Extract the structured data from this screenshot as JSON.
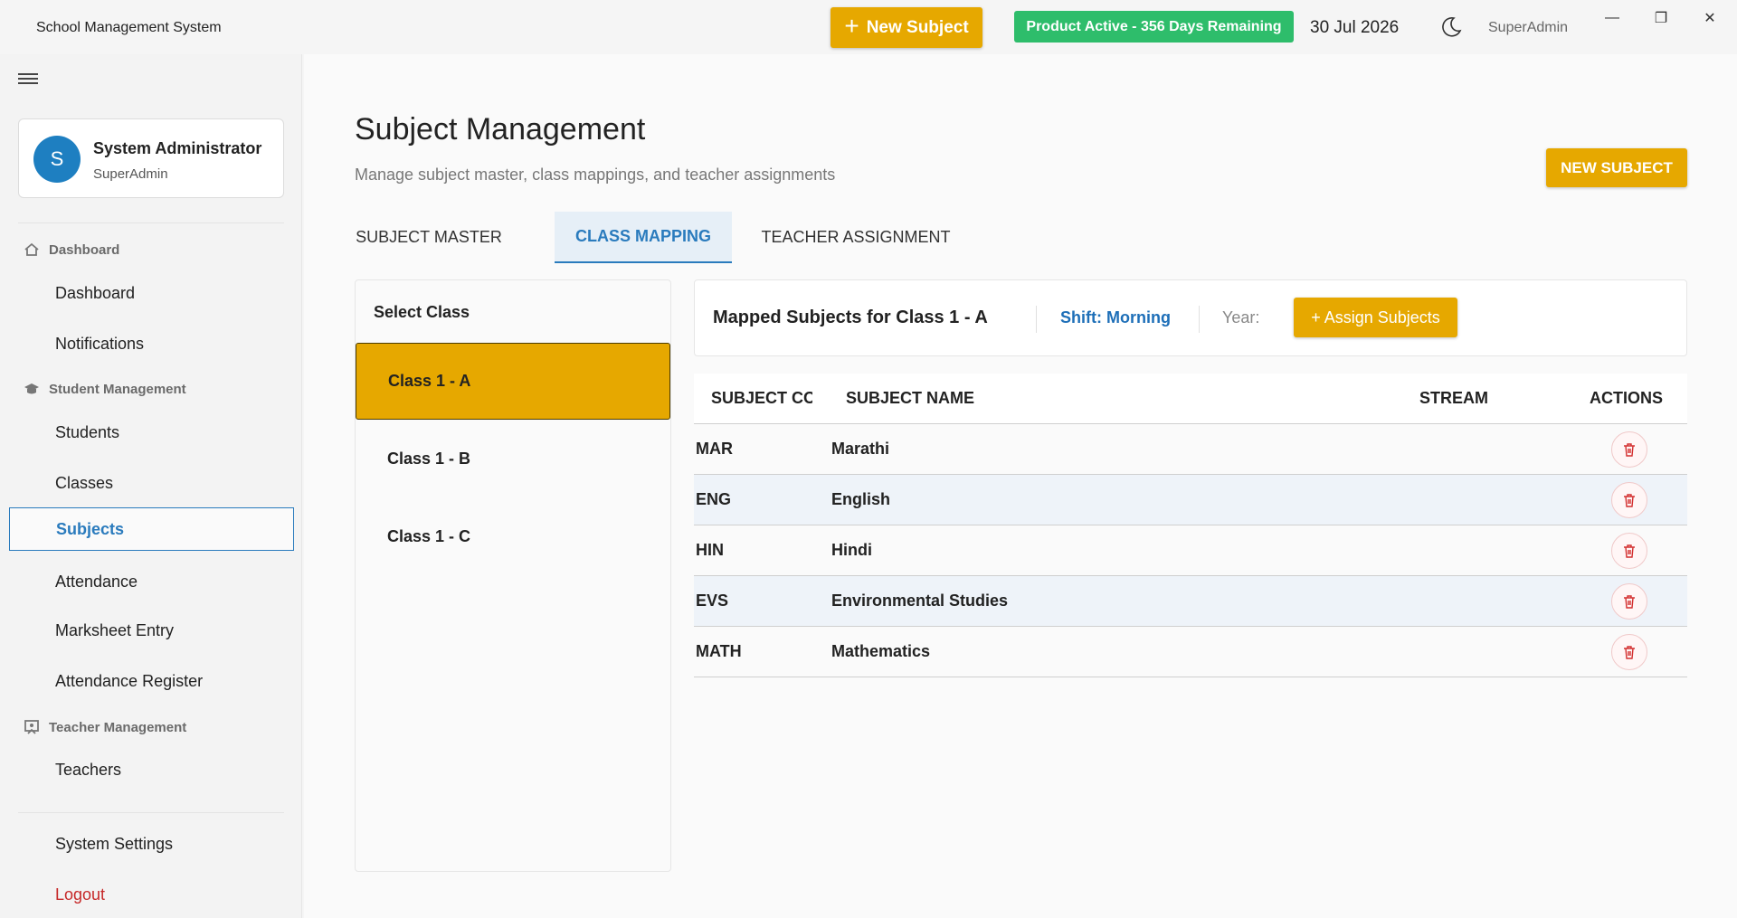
{
  "app": {
    "title": "School Management System",
    "new_subject_label": "New Subject",
    "product_status": "Product Active - 356 Days Remaining",
    "date": "30 Jul 2026",
    "user": "SuperAdmin",
    "theme_icon": "moon-icon"
  },
  "window_controls": {
    "minimize": "—",
    "maximize": "❐",
    "close": "✕"
  },
  "profile": {
    "initial": "S",
    "name": "System Administrator",
    "role": "SuperAdmin"
  },
  "sidebar": {
    "sections": [
      {
        "title": "Dashboard",
        "icon": "home-icon"
      },
      {
        "title": "Student Management",
        "icon": "graduation-cap-icon"
      },
      {
        "title": "Teacher Management",
        "icon": "teacher-icon"
      }
    ],
    "items": [
      {
        "label": "Dashboard"
      },
      {
        "label": "Notifications"
      },
      {
        "label": "Students"
      },
      {
        "label": "Classes"
      },
      {
        "label": "Subjects",
        "active": true
      },
      {
        "label": "Attendance"
      },
      {
        "label": "Marksheet Entry"
      },
      {
        "label": "Attendance Register"
      },
      {
        "label": "Teachers"
      },
      {
        "label": "System Settings"
      },
      {
        "label": "Logout"
      }
    ]
  },
  "page": {
    "title": "Subject Management",
    "subtitle": "Manage subject master, class mappings, and teacher assignments",
    "new_subject_button": "NEW SUBJECT",
    "tabs": [
      {
        "label": "SUBJECT MASTER"
      },
      {
        "label": "CLASS MAPPING",
        "active": true
      },
      {
        "label": "TEACHER ASSIGNMENT"
      }
    ]
  },
  "class_panel": {
    "title": "Select Class",
    "classes": [
      "Class 1 - A",
      "Class 1 - B",
      "Class 1 - C"
    ],
    "selected": "Class 1 - A"
  },
  "mapped": {
    "title": "Mapped Subjects for Class 1 - A",
    "shift": "Shift: Morning",
    "year": "Year:",
    "assign_button": "+ Assign Subjects"
  },
  "table": {
    "columns": [
      "SUBJECT CODE",
      "SUBJECT NAME",
      "STREAM",
      "ACTIONS"
    ],
    "rows": [
      {
        "code": "MAR",
        "name": "Marathi",
        "stream": ""
      },
      {
        "code": "ENG",
        "name": "English",
        "stream": ""
      },
      {
        "code": "HIN",
        "name": "Hindi",
        "stream": ""
      },
      {
        "code": "EVS",
        "name": "Environmental Studies",
        "stream": ""
      },
      {
        "code": "MATH",
        "name": "Mathematics",
        "stream": ""
      }
    ],
    "action_icon": "trash-icon"
  },
  "colors": {
    "accent": "#e6a800",
    "primary": "#2a7bbd",
    "success": "#2ebd6b",
    "danger": "#c62828"
  }
}
